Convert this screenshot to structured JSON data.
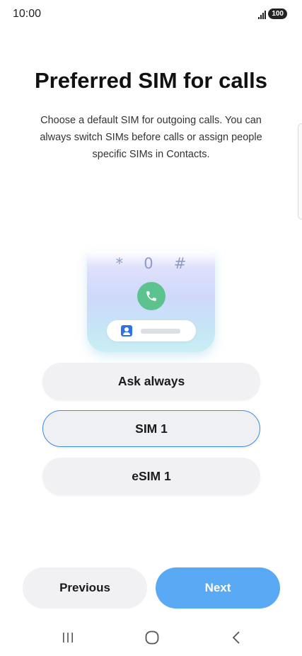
{
  "status_bar": {
    "time": "10:00",
    "battery": "100",
    "signal_icon": "signal-bars-icon"
  },
  "header": {
    "title": "Preferred SIM for calls",
    "description": "Choose a default SIM for outgoing calls. You can always switch SIMs before calls or assign people specific SIMs in Contacts."
  },
  "illustration": {
    "keys": [
      "*",
      "0",
      "#"
    ],
    "call_icon": "phone-icon",
    "contact_icon": "contact-avatar-icon",
    "call_color": "#5cc38f"
  },
  "options": [
    {
      "label": "Ask always",
      "selected": false
    },
    {
      "label": "SIM 1",
      "selected": true
    },
    {
      "label": "eSIM 1",
      "selected": false
    }
  ],
  "footer": {
    "previous_label": "Previous",
    "next_label": "Next",
    "accent_color": "#5aa9f5"
  },
  "nav_bar": {
    "recents_icon": "recents-icon",
    "home_icon": "home-icon",
    "back_icon": "back-icon"
  }
}
